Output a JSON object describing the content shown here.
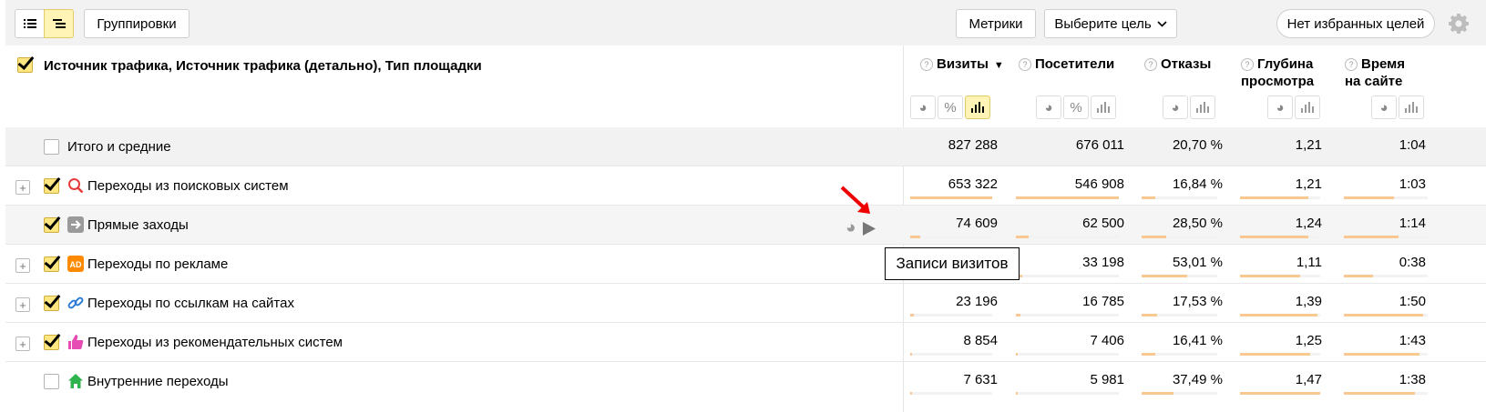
{
  "toolbar": {
    "groupings_label": "Группировки",
    "metrics_label": "Метрики",
    "goal_label": "Выберите цель",
    "favorites_label": "Нет избранных целей"
  },
  "header": {
    "dimensions_title": "Источник трафика, Источник трафика (детально), Тип площадки",
    "columns": [
      {
        "line1": "Визиты",
        "line2": "",
        "sorted": true
      },
      {
        "line1": "Посетители",
        "line2": ""
      },
      {
        "line1": "Отказы",
        "line2": ""
      },
      {
        "line1": "Глубина",
        "line2": "просмотра"
      },
      {
        "line1": "Время",
        "line2": "на сайте"
      }
    ]
  },
  "rows": [
    {
      "label": "Итого и средние",
      "visits": "827 288",
      "visitors": "676 011",
      "bounce": "20,70 %",
      "depth": "1,21",
      "time": "1:04"
    },
    {
      "label": "Переходы из поисковых систем",
      "visits": "653 322",
      "visitors": "546 908",
      "bounce": "16,84 %",
      "depth": "1,21",
      "time": "1:03",
      "bars": {
        "visits": 1.0,
        "visitors": 1.0,
        "bounce": 0.18,
        "depth": 0.85,
        "time": 0.6
      }
    },
    {
      "label": "Прямые заходы",
      "visits": "74 609",
      "visitors": "62 500",
      "bounce": "28,50 %",
      "depth": "1,24",
      "time": "1:14",
      "bars": {
        "visits": 0.12,
        "visitors": 0.12,
        "bounce": 0.32,
        "depth": 0.85,
        "time": 0.65
      }
    },
    {
      "label": "Переходы по рекламе",
      "visits": "",
      "visitors": "33 198",
      "bounce": "53,01 %",
      "depth": "1,11",
      "time": "0:38",
      "bars": {
        "visits": 0.06,
        "visitors": 0.06,
        "bounce": 0.6,
        "depth": 0.75,
        "time": 0.35
      }
    },
    {
      "label": "Переходы по ссылкам на сайтах",
      "visits": "23 196",
      "visitors": "16 785",
      "bounce": "17,53 %",
      "depth": "1,39",
      "time": "1:50",
      "bars": {
        "visits": 0.04,
        "visitors": 0.04,
        "bounce": 0.2,
        "depth": 0.97,
        "time": 0.95
      }
    },
    {
      "label": "Переходы из рекомендательных систем",
      "visits": "8 854",
      "visitors": "7 406",
      "bounce": "16,41 %",
      "depth": "1,25",
      "time": "1:43",
      "bars": {
        "visits": 0.02,
        "visitors": 0.02,
        "bounce": 0.18,
        "depth": 0.87,
        "time": 0.9
      }
    },
    {
      "label": "Внутренние переходы",
      "visits": "7 631",
      "visitors": "5 981",
      "bounce": "37,49 %",
      "depth": "1,47",
      "time": "1:38",
      "bars": {
        "visits": 0.02,
        "visitors": 0.02,
        "bounce": 0.42,
        "depth": 1.0,
        "time": 0.85
      }
    }
  ],
  "tooltip": "Записи визитов",
  "icons": {
    "search": "magnifier-icon",
    "direct": "arrow-right-icon",
    "ads": "ad-badge-icon",
    "links": "link-icon",
    "recommend": "thumbs-up-icon",
    "internal": "home-icon"
  },
  "ads_badge_text": "AD",
  "colors": {
    "accent_yellow": "#fff3b5",
    "bar": "#f9c790",
    "search_icon": "#e53b3b",
    "ad_icon": "#ff8a00",
    "link_icon": "#2e7bd6",
    "thumb_icon": "#e64bb4",
    "home_icon": "#2fb34c"
  }
}
